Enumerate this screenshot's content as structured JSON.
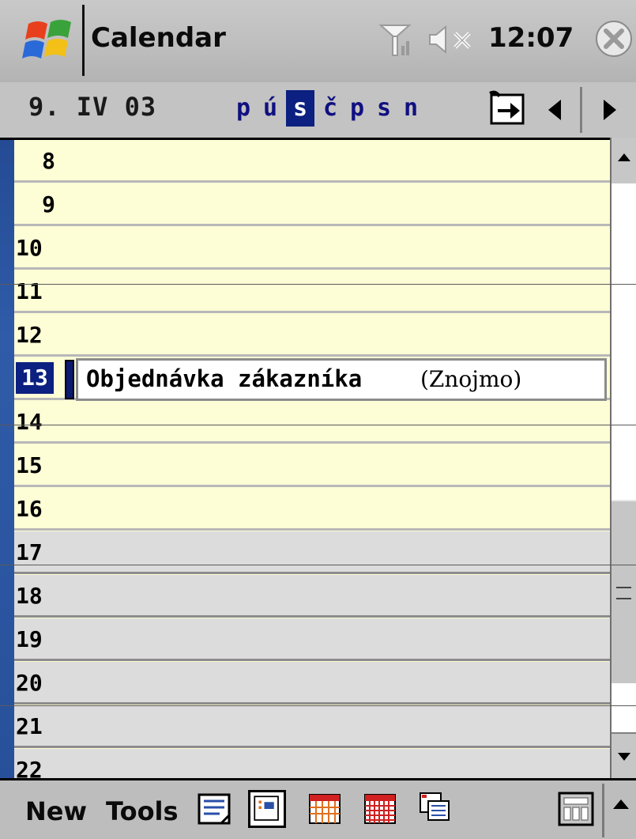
{
  "titlebar": {
    "app_title": "Calendar",
    "clock": "12:07",
    "icons": [
      "windows-start-icon",
      "signal-icon",
      "volume-muted-icon",
      "close-icon"
    ]
  },
  "navbar": {
    "date": "9. IV 03",
    "weekdays": [
      "p",
      "ú",
      "s",
      "č",
      "p",
      "s",
      "n"
    ],
    "selected_weekday_index": 2,
    "icons": [
      "goto-today-icon",
      "prev-arrow-icon",
      "next-arrow-icon"
    ]
  },
  "day_view": {
    "hours": [
      "8",
      "9",
      "10",
      "11",
      "12",
      "13",
      "14",
      "15",
      "16",
      "17",
      "18",
      "19",
      "20",
      "21",
      "22"
    ],
    "current_hour": "13",
    "appointment": {
      "title": "Objednávka zákazníka",
      "location": "(Znojmo)",
      "hour": "13"
    }
  },
  "toolbar": {
    "new_label": "New",
    "tools_label": "Tools",
    "view_icons": [
      "agenda-view-icon",
      "day-view-icon",
      "week-view-icon",
      "month-view-icon",
      "year-view-icon"
    ],
    "active_view": "day-view-icon"
  },
  "colors": {
    "selection": "#0b2080",
    "work_hours_bg": "#fdfdd6",
    "off_hours_bg": "#dcdcdc"
  }
}
